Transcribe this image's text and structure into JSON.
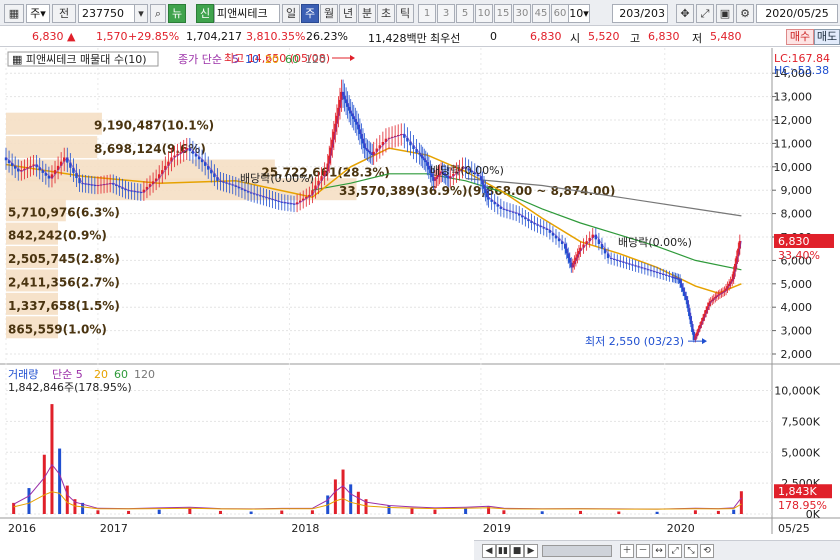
{
  "toolbar": {
    "menu_icon": "grid-icon",
    "period": "주",
    "prev": "전",
    "code": "237750",
    "news": "뉴",
    "credit": "신",
    "stock_name": "피앤씨테크",
    "tabs": [
      "일",
      "주",
      "월",
      "년",
      "분",
      "초",
      "틱"
    ],
    "active_tab": "주",
    "intervals": [
      "1",
      "3",
      "5",
      "10",
      "15",
      "30",
      "45",
      "60"
    ],
    "interval_sel": "10",
    "count": "203",
    "count_total": "/203",
    "date": "2020/05/25"
  },
  "quote": {
    "price": "6,830",
    "change": "1,570",
    "change_pct": "+29.85%",
    "volume": "1,704,217",
    "vol_ratio": "3,810.35%",
    "turnover": "26.23%",
    "amount": "11,428백만",
    "pref_label": "최우선",
    "pref_value": "0",
    "last": "6,830",
    "open_label": "시",
    "open": "5,520",
    "high_label": "고",
    "high": "6,830",
    "low_label": "저",
    "low": "5,480",
    "buy": "매수",
    "sell": "매도"
  },
  "chart_data": {
    "type": "candlestick",
    "title": "피앤씨테크 매물대 수(10)",
    "price_legend": [
      "종가 단순",
      "5",
      "10",
      "20",
      "60",
      "120"
    ],
    "volume_legend": [
      "거래량",
      "단순 5",
      "20",
      "60",
      "120"
    ],
    "lc": "LC:167.84",
    "hc": "HC:-53.38",
    "ylim": [
      2000,
      14650
    ],
    "yticks": [
      {
        "v": 14000,
        "label": "14,000"
      },
      {
        "v": 13000,
        "label": "13,000"
      },
      {
        "v": 12000,
        "label": "12,000"
      },
      {
        "v": 11000,
        "label": "11,000"
      },
      {
        "v": 10000,
        "label": "10,000"
      },
      {
        "v": 9000,
        "label": "9,000"
      },
      {
        "v": 8000,
        "label": "8,000"
      },
      {
        "v": 7000,
        "label": "7,000"
      },
      {
        "v": 6000,
        "label": "6,000"
      },
      {
        "v": 5000,
        "label": "5,000"
      },
      {
        "v": 4000,
        "label": "4,000"
      },
      {
        "v": 3000,
        "label": "3,000"
      },
      {
        "v": 2000,
        "label": "2,000"
      }
    ],
    "last_price": {
      "value": 6830,
      "label": "6,830",
      "pct": "33.40%"
    },
    "high_note": {
      "text": "최고 14,650 (05/08)",
      "value": 14650
    },
    "low_note": {
      "text": "최저 2,550 (03/23)",
      "value": 2550
    },
    "dividends": [
      "배당락(0.00%)",
      "배당락(0.00%)",
      "배당락(0.00%)"
    ],
    "volume_profile": [
      {
        "price": 11800,
        "label": "9,190,487(10.1%)",
        "pct": 10.1
      },
      {
        "price": 10800,
        "label": "8,698,124(9.6%)",
        "pct": 9.6
      },
      {
        "price": 9800,
        "label": "25,722,661(28.3%)",
        "pct": 28.3
      },
      {
        "price": 9000,
        "label": "33,570,389(36.9%)(9,868.00 ~ 8,874.00)",
        "pct": 36.9
      },
      {
        "price": 8100,
        "label": "5,710,976(6.3%)",
        "pct": 6.3
      },
      {
        "price": 7100,
        "label": "842,242(0.9%)",
        "pct": 0.9
      },
      {
        "price": 6100,
        "label": "2,505,745(2.8%)",
        "pct": 2.8
      },
      {
        "price": 5100,
        "label": "2,411,356(2.7%)",
        "pct": 2.7
      },
      {
        "price": 4100,
        "label": "1,337,658(1.5%)",
        "pct": 1.5
      },
      {
        "price": 3100,
        "label": "865,559(1.0%)",
        "pct": 1.0
      }
    ],
    "x_labels": [
      {
        "t": 0.0,
        "label": "2016"
      },
      {
        "t": 0.12,
        "label": "2017"
      },
      {
        "t": 0.37,
        "label": "2018"
      },
      {
        "t": 0.62,
        "label": "2019"
      },
      {
        "t": 0.86,
        "label": "2020"
      }
    ],
    "x_last_label": "05/25",
    "price_path": [
      [
        0.0,
        10400
      ],
      [
        0.02,
        9800
      ],
      [
        0.04,
        10100
      ],
      [
        0.06,
        9500
      ],
      [
        0.08,
        10400
      ],
      [
        0.1,
        9300
      ],
      [
        0.12,
        9200
      ],
      [
        0.14,
        9300
      ],
      [
        0.16,
        9000
      ],
      [
        0.18,
        8900
      ],
      [
        0.2,
        9500
      ],
      [
        0.22,
        10400
      ],
      [
        0.24,
        10800
      ],
      [
        0.26,
        10200
      ],
      [
        0.28,
        9400
      ],
      [
        0.3,
        9200
      ],
      [
        0.32,
        8900
      ],
      [
        0.34,
        8700
      ],
      [
        0.36,
        8500
      ],
      [
        0.38,
        8400
      ],
      [
        0.4,
        8800
      ],
      [
        0.42,
        9800
      ],
      [
        0.43,
        11500
      ],
      [
        0.44,
        13200
      ],
      [
        0.45,
        12400
      ],
      [
        0.46,
        11800
      ],
      [
        0.47,
        10800
      ],
      [
        0.48,
        10500
      ],
      [
        0.5,
        11200
      ],
      [
        0.52,
        11400
      ],
      [
        0.54,
        10600
      ],
      [
        0.55,
        10200
      ],
      [
        0.56,
        9400
      ],
      [
        0.57,
        9800
      ],
      [
        0.58,
        9500
      ],
      [
        0.6,
        10000
      ],
      [
        0.62,
        9600
      ],
      [
        0.63,
        8700
      ],
      [
        0.65,
        8200
      ],
      [
        0.67,
        8000
      ],
      [
        0.69,
        7600
      ],
      [
        0.71,
        7300
      ],
      [
        0.73,
        6700
      ],
      [
        0.74,
        5700
      ],
      [
        0.75,
        6400
      ],
      [
        0.77,
        7100
      ],
      [
        0.79,
        6100
      ],
      [
        0.81,
        5900
      ],
      [
        0.83,
        5700
      ],
      [
        0.85,
        5500
      ],
      [
        0.87,
        5300
      ],
      [
        0.88,
        5200
      ],
      [
        0.89,
        4300
      ],
      [
        0.9,
        2600
      ],
      [
        0.91,
        3400
      ],
      [
        0.92,
        4200
      ],
      [
        0.93,
        4500
      ],
      [
        0.94,
        4700
      ],
      [
        0.95,
        5200
      ],
      [
        0.96,
        6830
      ]
    ],
    "ma20_path": [
      [
        0.0,
        10100
      ],
      [
        0.1,
        9600
      ],
      [
        0.2,
        9300
      ],
      [
        0.3,
        9400
      ],
      [
        0.4,
        8700
      ],
      [
        0.45,
        10000
      ],
      [
        0.5,
        10800
      ],
      [
        0.55,
        10500
      ],
      [
        0.6,
        9800
      ],
      [
        0.65,
        8900
      ],
      [
        0.7,
        7800
      ],
      [
        0.75,
        6800
      ],
      [
        0.8,
        6300
      ],
      [
        0.85,
        5700
      ],
      [
        0.9,
        4900
      ],
      [
        0.93,
        4600
      ],
      [
        0.96,
        5000
      ]
    ],
    "ma60_path": [
      [
        0.4,
        9000
      ],
      [
        0.45,
        9300
      ],
      [
        0.5,
        9700
      ],
      [
        0.55,
        9700
      ],
      [
        0.6,
        9400
      ],
      [
        0.65,
        8900
      ],
      [
        0.7,
        8200
      ],
      [
        0.75,
        7600
      ],
      [
        0.8,
        7100
      ],
      [
        0.85,
        6600
      ],
      [
        0.9,
        6000
      ],
      [
        0.96,
        5600
      ]
    ],
    "ma120_path": [
      [
        0.6,
        9500
      ],
      [
        0.7,
        9200
      ],
      [
        0.8,
        8700
      ],
      [
        0.9,
        8200
      ],
      [
        0.96,
        7900
      ]
    ],
    "volume": {
      "ylim": [
        0,
        11500
      ],
      "yticks": [
        {
          "v": 10000,
          "label": "10,000K"
        },
        {
          "v": 7500,
          "label": "7,500K"
        },
        {
          "v": 5000,
          "label": "5,000K"
        },
        {
          "v": 2500,
          "label": "2,500K"
        },
        {
          "v": 0,
          "label": "0K"
        }
      ],
      "summary": "1,842,846주(178.95%)",
      "last_label": "1,843K",
      "last_pct": "178.95%",
      "last_value": 1843,
      "bars": [
        [
          0.01,
          900
        ],
        [
          0.03,
          2100
        ],
        [
          0.05,
          4800
        ],
        [
          0.06,
          8900
        ],
        [
          0.07,
          5300
        ],
        [
          0.08,
          2300
        ],
        [
          0.09,
          1200
        ],
        [
          0.1,
          900
        ],
        [
          0.12,
          300
        ],
        [
          0.16,
          250
        ],
        [
          0.2,
          350
        ],
        [
          0.24,
          450
        ],
        [
          0.28,
          250
        ],
        [
          0.32,
          200
        ],
        [
          0.36,
          280
        ],
        [
          0.4,
          300
        ],
        [
          0.42,
          1500
        ],
        [
          0.43,
          2800
        ],
        [
          0.44,
          3600
        ],
        [
          0.45,
          2400
        ],
        [
          0.46,
          1800
        ],
        [
          0.47,
          1200
        ],
        [
          0.5,
          700
        ],
        [
          0.53,
          500
        ],
        [
          0.56,
          350
        ],
        [
          0.6,
          450
        ],
        [
          0.63,
          600
        ],
        [
          0.65,
          300
        ],
        [
          0.7,
          220
        ],
        [
          0.75,
          250
        ],
        [
          0.8,
          200
        ],
        [
          0.85,
          180
        ],
        [
          0.9,
          300
        ],
        [
          0.93,
          250
        ],
        [
          0.95,
          350
        ],
        [
          0.96,
          1843
        ]
      ]
    }
  }
}
